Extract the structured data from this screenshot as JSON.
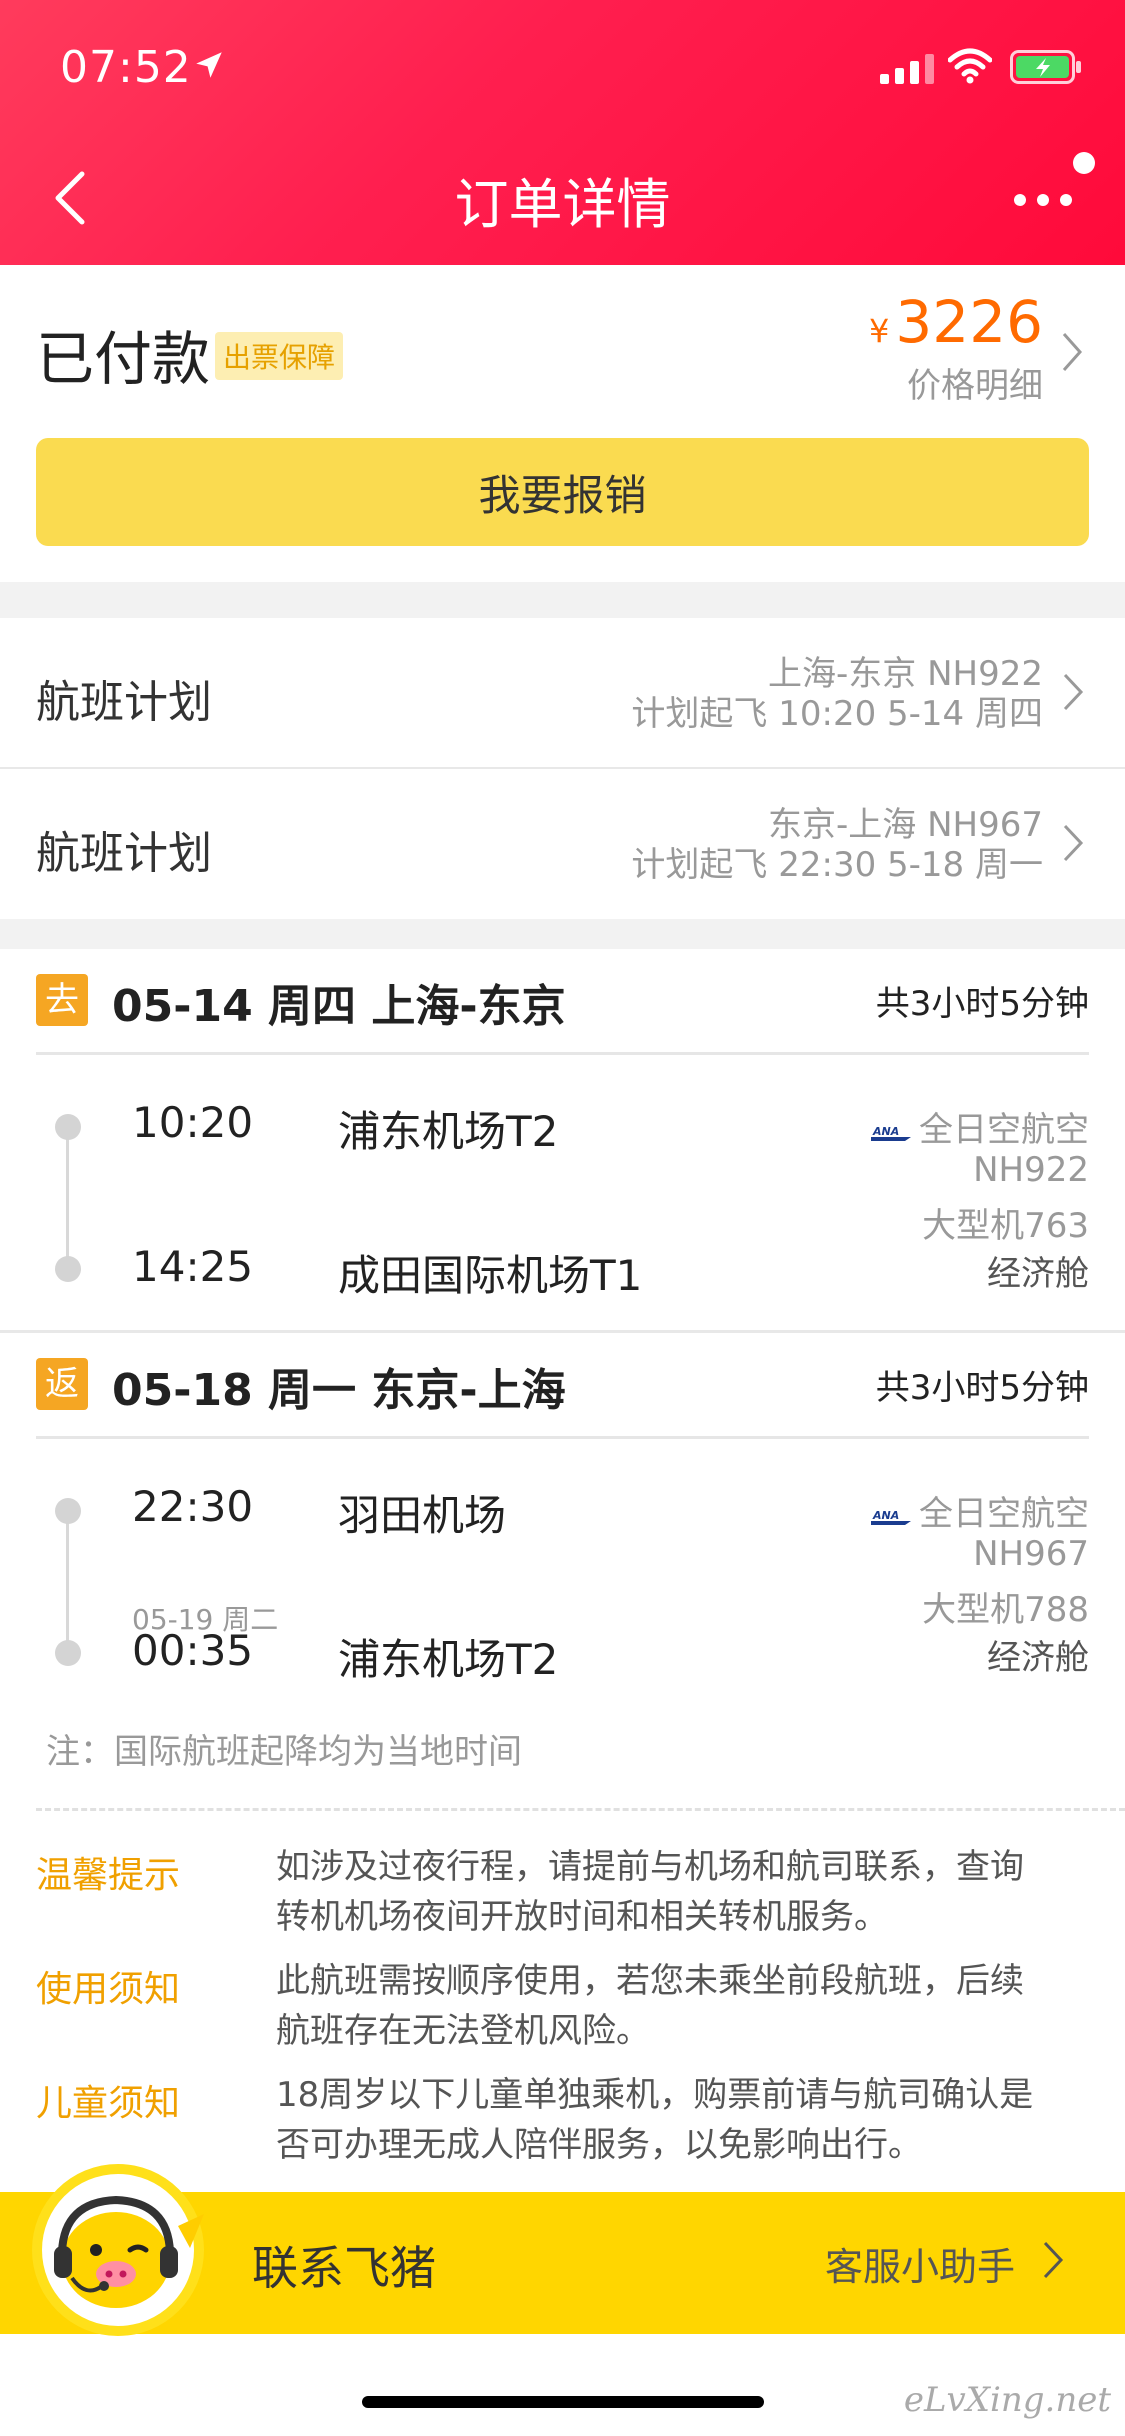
{
  "status_bar": {
    "time": "07:52"
  },
  "nav": {
    "title": "订单详情"
  },
  "order": {
    "status": "已付款",
    "guarantee_badge": "出票保障",
    "currency": "¥",
    "price": "3226",
    "price_detail_label": "价格明细",
    "reimburse_button": "我要报销"
  },
  "flight_plans": [
    {
      "label": "航班计划",
      "route": "上海-东京 NH922",
      "schedule": "计划起飞 10:20 5-14 周四"
    },
    {
      "label": "航班计划",
      "route": "东京-上海 NH967",
      "schedule": "计划起飞 22:30 5-18 周一"
    }
  ],
  "segments": [
    {
      "tag": "去",
      "title": "05-14 周四 上海-东京",
      "duration": "共3小时5分钟",
      "dep_time": "10:20",
      "dep_airport": "浦东机场T2",
      "arr_time": "14:25",
      "arr_airport": "成田国际机场T1",
      "arr_next_day": "",
      "airline": "全日空航空",
      "flight_no": "NH922",
      "aircraft": "大型机763",
      "cabin": "经济舱"
    },
    {
      "tag": "返",
      "title": "05-18 周一 东京-上海",
      "duration": "共3小时5分钟",
      "dep_time": "22:30",
      "dep_airport": "羽田机场",
      "arr_time": "00:35",
      "arr_airport": "浦东机场T2",
      "arr_next_day": "05-19 周二",
      "airline": "全日空航空",
      "flight_no": "NH967",
      "aircraft": "大型机788",
      "cabin": "经济舱"
    }
  ],
  "note": "注：国际航班起降均为当地时间",
  "tips": [
    {
      "label": "温馨提示",
      "lines": [
        "如涉及过夜行程，请提前与机场和航司联系，查询",
        "转机机场夜间开放时间和相关转机服务。"
      ]
    },
    {
      "label": "使用须知",
      "lines": [
        "此航班需按顺序使用，若您未乘坐前段航班，后续",
        "航班存在无法登机风险。"
      ]
    },
    {
      "label": "儿童须知",
      "lines": [
        "18周岁以下儿童单独乘机，购票前请与航司确认是",
        "否可办理无成人陪伴服务，以免影响出行。"
      ]
    }
  ],
  "contact": {
    "label": "联系飞猪",
    "service": "客服小助手"
  },
  "watermark": "eLvXing.net",
  "colors": {
    "header": "#ff1f4f",
    "accent_orange": "#ff6a00",
    "button_yellow": "#fadb50",
    "tag_orange": "#f5a623",
    "contact_yellow": "#ffd600"
  },
  "icons": [
    "location-arrow-icon",
    "signal-icon",
    "wifi-icon",
    "battery-icon",
    "back-icon",
    "more-icon",
    "chevron-right-icon",
    "ana-logo-icon",
    "mascot-icon"
  ]
}
